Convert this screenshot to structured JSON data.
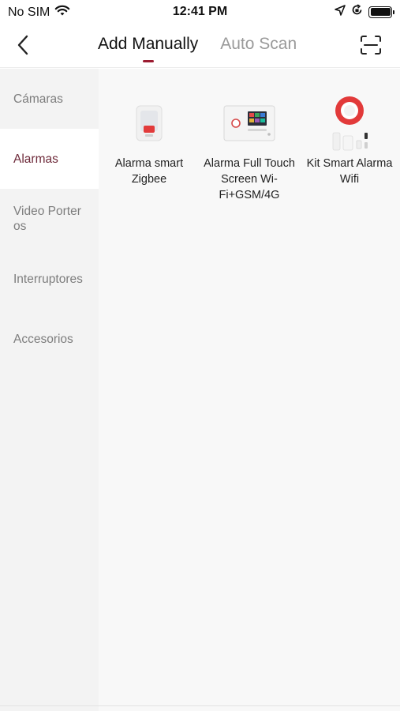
{
  "status": {
    "carrier": "No SIM",
    "time": "12:41 PM"
  },
  "header": {
    "tabs": [
      {
        "label": "Add Manually",
        "active": true
      },
      {
        "label": "Auto Scan",
        "active": false
      }
    ]
  },
  "sidebar": {
    "items": [
      {
        "label": "Cámaras",
        "active": false
      },
      {
        "label": "Alarmas",
        "active": true
      },
      {
        "label": "Video Porteros",
        "active": false
      },
      {
        "label": "Interruptores",
        "active": false
      },
      {
        "label": "Accesorios",
        "active": false
      }
    ]
  },
  "products": [
    {
      "name": "Alarma smart Zigbee",
      "image": "siren-device-icon"
    },
    {
      "name": "Alarma Full Touch Screen Wi-Fi+GSM/4G",
      "image": "touch-panel-icon"
    },
    {
      "name": "Kit Smart Alarma Wifi",
      "image": "alarm-kit-icon"
    }
  ],
  "colors": {
    "accent": "#9b1b30",
    "sidebar_bg": "#f3f3f3",
    "sidebar_active_text": "#6e2a3a",
    "main_bg": "#f8f8f8"
  }
}
